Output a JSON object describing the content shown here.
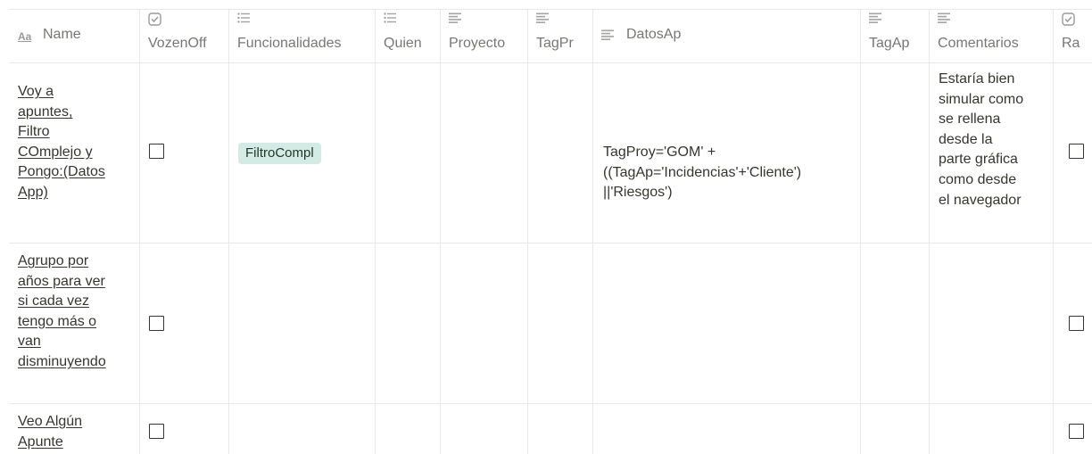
{
  "columns": [
    {
      "key": "name",
      "label": "Name",
      "icon": "text-aa-icon"
    },
    {
      "key": "vozenoff",
      "label": "VozenOff",
      "icon": "checkbox-icon"
    },
    {
      "key": "funcionalidades",
      "label": "Funcionalidades",
      "icon": "multi-select-icon"
    },
    {
      "key": "quien",
      "label": "Quien",
      "icon": "multi-select-icon"
    },
    {
      "key": "proyecto",
      "label": "Proyecto",
      "icon": "text-lines-icon"
    },
    {
      "key": "tagpr",
      "label": "TagPr",
      "icon": "text-lines-icon"
    },
    {
      "key": "datosap",
      "label": "DatosAp",
      "icon": "text-lines-icon"
    },
    {
      "key": "tagap",
      "label": "TagAp",
      "icon": "text-lines-icon"
    },
    {
      "key": "comentarios",
      "label": "Comentarios",
      "icon": "text-lines-icon"
    },
    {
      "key": "ra",
      "label": "Ra",
      "icon": "checkbox-icon"
    }
  ],
  "rows": [
    {
      "name_lines": [
        "Voy a",
        "apuntes,",
        "Filtro",
        "COmplejo y",
        "Pongo:(Datos",
        "App)"
      ],
      "vozenoff": false,
      "funcionalidades_tag": "FiltroCompl",
      "datosap_lines": [
        "TagProy='GOM' +",
        "((TagAp='Incidencias'+'Cliente')",
        "||'Riesgos')"
      ],
      "comentarios_lines": [
        "Estaría bien",
        "simular como",
        "se rellena",
        "desde la",
        "parte gráfica",
        "como desde",
        "el navegador"
      ],
      "ra": false
    },
    {
      "name_lines": [
        "Agrupo por",
        "años para ver",
        "si cada vez",
        "tengo más o",
        "van",
        "disminuyendo"
      ],
      "vozenoff": false,
      "ra": false
    },
    {
      "name_lines": [
        "Veo Algún",
        "Apunte"
      ],
      "vozenoff": false,
      "ra": false
    }
  ]
}
